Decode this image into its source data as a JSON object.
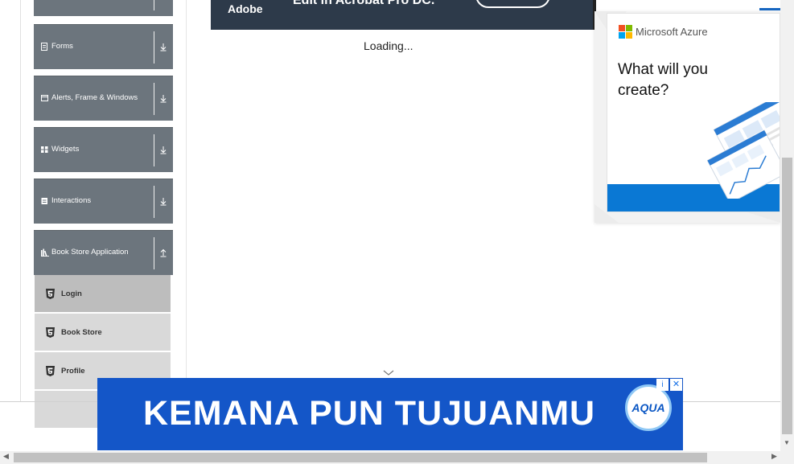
{
  "sidebar": {
    "groups": [
      {
        "label": "",
        "icon": "collapsed-group-icon"
      },
      {
        "label": "Forms",
        "icon": "form-icon",
        "toggle": "expand-arrow-icon"
      },
      {
        "label": "Alerts, Frame & Windows",
        "icon": "window-icon",
        "toggle": "expand-arrow-icon"
      },
      {
        "label": "Widgets",
        "icon": "widgets-icon",
        "toggle": "expand-arrow-icon"
      },
      {
        "label": "Interactions",
        "icon": "interactions-icon",
        "toggle": "expand-arrow-icon"
      },
      {
        "label": "Book Store Application",
        "icon": "book-icon",
        "toggle": "collapse-arrow-icon"
      }
    ],
    "items": [
      {
        "label": "Login",
        "icon": "html5-icon",
        "active": true
      },
      {
        "label": "Book Store",
        "icon": "html5-icon"
      },
      {
        "label": "Profile",
        "icon": "html5-icon"
      }
    ]
  },
  "top_ad": {
    "brand": "Adobe",
    "headline": "Edit in Acrobat Pro DC."
  },
  "main": {
    "loading_text": "Loading..."
  },
  "side_ad": {
    "brand": "Microsoft Azure",
    "tagline": "What will you create?",
    "colors": {
      "accent": "#0a78d4"
    }
  },
  "bottom_ad": {
    "slogan": "KEMANA PUN TUJUANMU",
    "logo_text": "AQUA",
    "info_label": "i",
    "close_label": "✕",
    "colors": {
      "background": "#1456c8"
    }
  }
}
